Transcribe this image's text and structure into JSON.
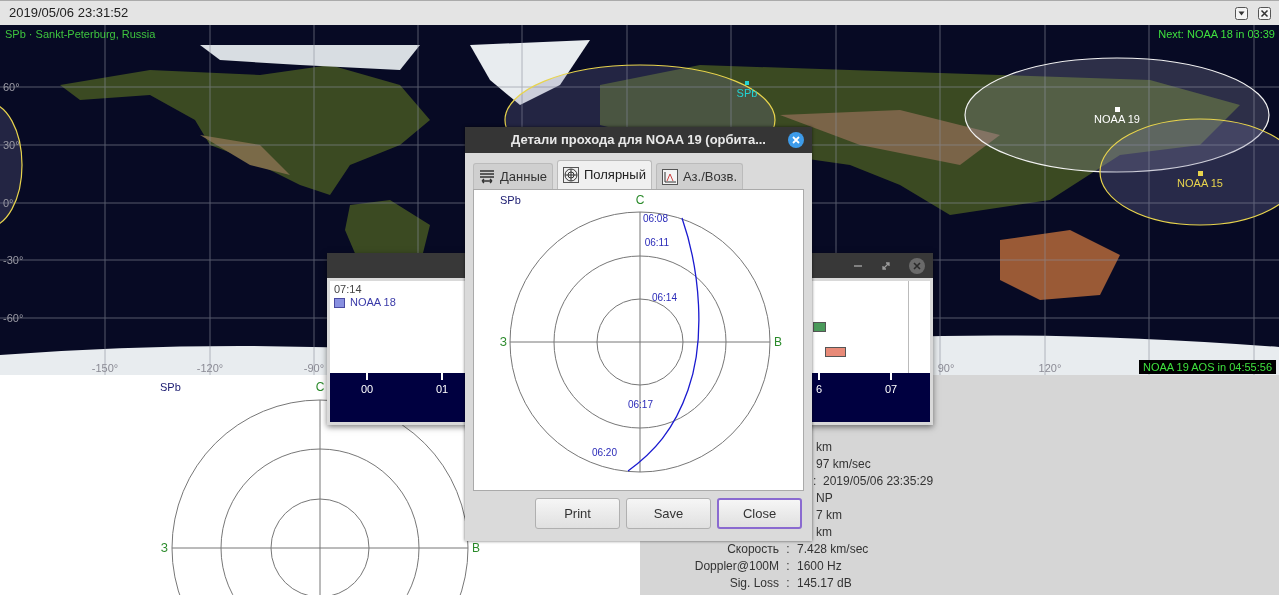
{
  "window": {
    "title": "2019/05/06 23:31:52"
  },
  "map": {
    "location": "SPb · Sankt-Peterburg, Russia",
    "next_pass": "Next: NOAA 18 in 03:39",
    "latitudes": [
      "60°",
      "30°",
      "0°",
      "-30°",
      "-60°"
    ],
    "longitudes": [
      "-150°",
      "-120°",
      "-90°",
      "90°",
      "120°"
    ],
    "objects": [
      {
        "name": "SPb",
        "kind": "station",
        "color": "#22d3d3"
      },
      {
        "name": "NOAA 19",
        "kind": "satellite",
        "color": "#ffffff"
      },
      {
        "name": "NOAA 15",
        "kind": "satellite",
        "color": "#e8d44d"
      }
    ],
    "aos": "NOAA 19 AOS in 04:55:56"
  },
  "polar_view": {
    "station": "SPb",
    "north": "С",
    "west": "З",
    "east": "В"
  },
  "details_panel": {
    "rows": [
      {
        "value": "km"
      },
      {
        "value": "97 km/sec"
      },
      {
        "sep": ":",
        "value": "2019/05/06 23:35:29"
      },
      {
        "value": "NP"
      },
      {
        "value": "7 km"
      },
      {
        "value": "km"
      },
      {
        "label": "Скорость",
        "sep": ":",
        "value": "7.428 km/sec"
      },
      {
        "label": "Doppler@100M",
        "sep": ":",
        "value": "1600 Hz"
      },
      {
        "label": "Sig. Loss",
        "sep": ":",
        "value": "145.17 dB"
      }
    ]
  },
  "timeline_window": {
    "time": "07:14",
    "legend": [
      {
        "name": "NOAA 18",
        "color": "#8890e0"
      }
    ],
    "bars": [
      {
        "color": "#4a9a5a"
      },
      {
        "color": "#e88a78"
      }
    ],
    "hours": [
      "00",
      "01",
      "6",
      "07"
    ]
  },
  "dialog": {
    "title": "Детали прохода для NOAA 19 (орбита...",
    "tabs": [
      {
        "label": "Данные",
        "selected": false
      },
      {
        "label": "Полярный",
        "selected": true
      },
      {
        "label": "Аз./Возв.",
        "selected": false
      }
    ],
    "plot": {
      "station": "SPb",
      "north": "С",
      "west": "З",
      "east": "В",
      "times": [
        "06:08",
        "06:11",
        "06:14",
        "06:17",
        "06:20"
      ]
    },
    "buttons": [
      {
        "label": "Print",
        "focused": false
      },
      {
        "label": "Save",
        "focused": false
      },
      {
        "label": "Close",
        "focused": true
      }
    ]
  }
}
